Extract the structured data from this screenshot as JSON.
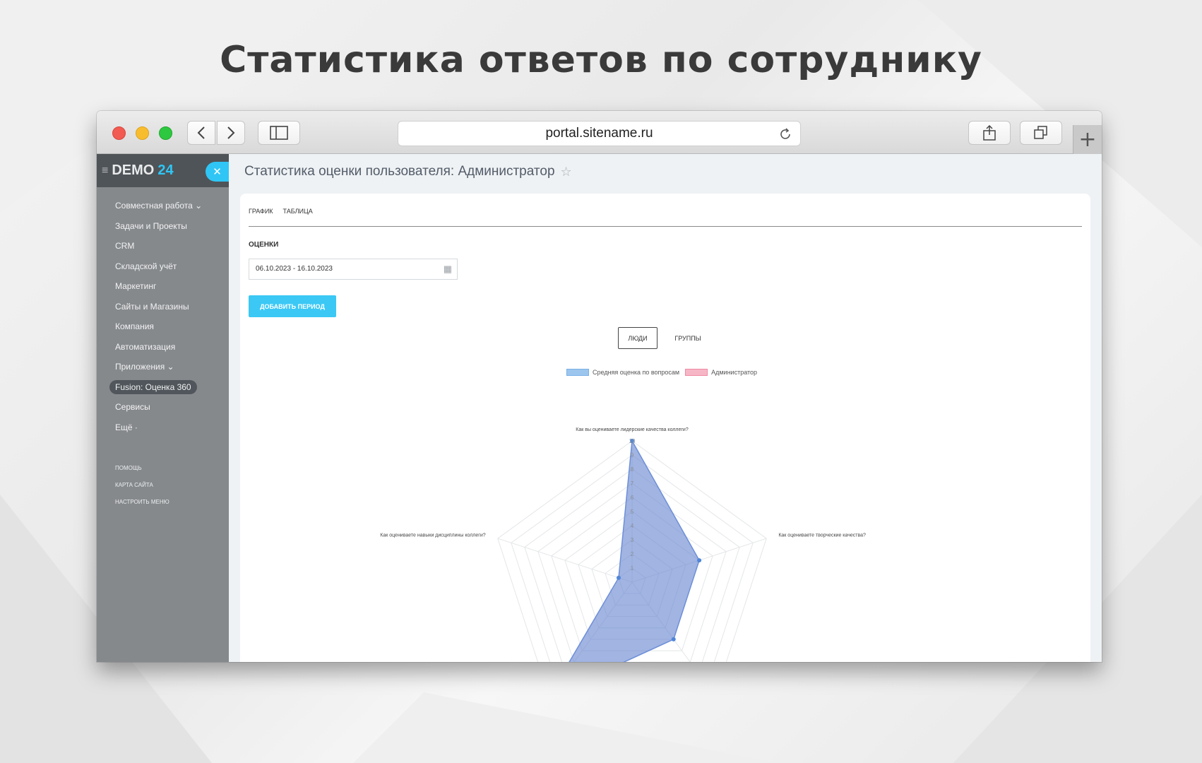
{
  "hero": {
    "title": "Статистика ответов по сотруднику"
  },
  "browser": {
    "url": "portal.sitename.ru"
  },
  "sidebar": {
    "logo": "DEMO",
    "logo_number": "24",
    "items": [
      {
        "label": "Совместная работа ⌄"
      },
      {
        "label": "Задачи и Проекты"
      },
      {
        "label": "CRM"
      },
      {
        "label": "Складской учёт"
      },
      {
        "label": "Маркетинг"
      },
      {
        "label": "Сайты и Магазины"
      },
      {
        "label": "Компания"
      },
      {
        "label": "Автоматизация"
      },
      {
        "label": "Приложения ⌄"
      },
      {
        "label": "Fusion: Оценка 360"
      },
      {
        "label": "Сервисы"
      },
      {
        "label": "Ещё ·"
      }
    ],
    "footer_items": [
      {
        "label": "ПОМОЩЬ"
      },
      {
        "label": "КАРТА САЙТА"
      },
      {
        "label": "НАСТРОИТЬ МЕНЮ"
      }
    ]
  },
  "page": {
    "title": "Статистика оценки пользователя: Администратор",
    "tabs": [
      {
        "label": "ГРАФИК"
      },
      {
        "label": "ТАБЛИЦА"
      }
    ],
    "section_label": "ОЦЕНКИ",
    "date_range": "06.10.2023 - 16.10.2023",
    "add_period_label": "ДОБАВИТЬ ПЕРИОД",
    "segment": {
      "people": "ЛЮДИ",
      "groups": "ГРУППЫ"
    }
  },
  "chart_data": {
    "type": "radar",
    "axes": [
      "Как вы оцениваете лидерские качества коллеги?",
      "Как оцениваете творческие качества?",
      "",
      "",
      "Как оцениваете навыки дисциплины коллеги?"
    ],
    "scale_ticks": [
      "1",
      "2",
      "3",
      "4",
      "5",
      "6",
      "7",
      "8",
      "9",
      "10"
    ],
    "rmax": 10,
    "series": [
      {
        "name": "Средняя оценка по вопросам",
        "values": [
          10,
          5,
          5,
          10,
          1
        ],
        "color": "#7f9ad8"
      },
      {
        "name": "Администратор",
        "values": [],
        "color": "#f5a0b4"
      }
    ]
  }
}
